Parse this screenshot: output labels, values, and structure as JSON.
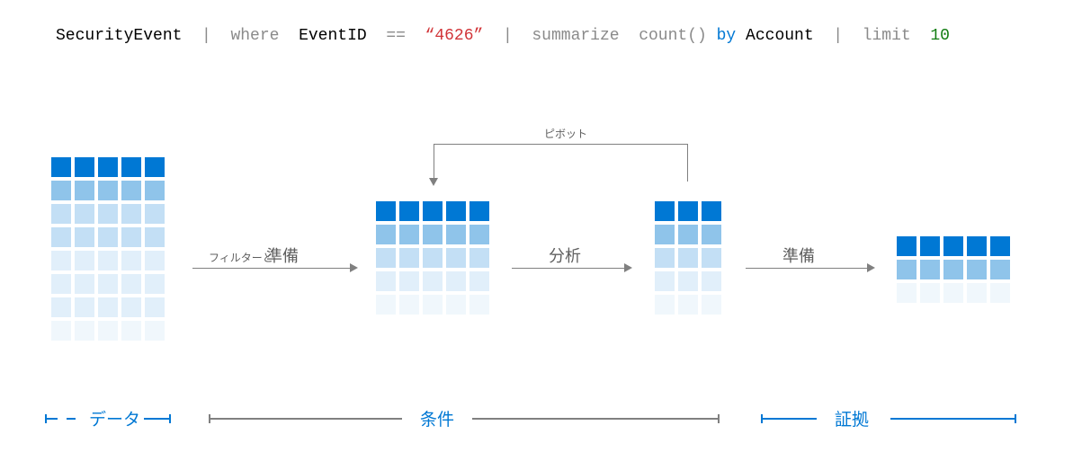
{
  "query": {
    "tokens": [
      {
        "text": "SecurityEvent",
        "class": "tk-black"
      },
      {
        "text": "  |  ",
        "class": "tk-gray"
      },
      {
        "text": "where",
        "class": "tk-gray"
      },
      {
        "text": "  ",
        "class": "tk-gray"
      },
      {
        "text": "EventID",
        "class": "tk-black"
      },
      {
        "text": "  ",
        "class": "tk-gray"
      },
      {
        "text": "==",
        "class": "tk-gray"
      },
      {
        "text": "  ",
        "class": "tk-gray"
      },
      {
        "text": "“4626”",
        "class": "tk-red"
      },
      {
        "text": "  |  ",
        "class": "tk-gray"
      },
      {
        "text": "summarize",
        "class": "tk-gray"
      },
      {
        "text": "  ",
        "class": "tk-gray"
      },
      {
        "text": "count()",
        "class": "tk-gray"
      },
      {
        "text": " ",
        "class": "tk-gray"
      },
      {
        "text": "by",
        "class": "tk-blue"
      },
      {
        "text": " ",
        "class": "tk-gray"
      },
      {
        "text": "Account",
        "class": "tk-black"
      },
      {
        "text": "  |  ",
        "class": "tk-gray"
      },
      {
        "text": "limit",
        "class": "tk-gray"
      },
      {
        "text": "  ",
        "class": "tk-gray"
      },
      {
        "text": "10",
        "class": "tk-green"
      }
    ]
  },
  "grids": {
    "data": {
      "cols": 5,
      "rows": 8,
      "shades": [
        "dark",
        "med",
        "light",
        "light",
        "pale",
        "pale",
        "pale",
        "faint"
      ]
    },
    "filtered": {
      "cols": 5,
      "rows": 5,
      "shades": [
        "dark",
        "med",
        "light",
        "pale",
        "faint"
      ]
    },
    "analyzed": {
      "cols": 3,
      "rows": 5,
      "shades": [
        "dark",
        "med",
        "light",
        "pale",
        "faint"
      ]
    },
    "evidence": {
      "cols": 5,
      "rows": 3,
      "shades": [
        "dark",
        "med",
        "faint"
      ]
    }
  },
  "labels": {
    "filter_prefix": "フィルターと",
    "filter_prepare": "準備",
    "analyze": "分析",
    "prepare": "準備",
    "pivot": "ピボット",
    "section_data": "データ",
    "section_criteria": "条件",
    "section_evidence": "証拠"
  }
}
